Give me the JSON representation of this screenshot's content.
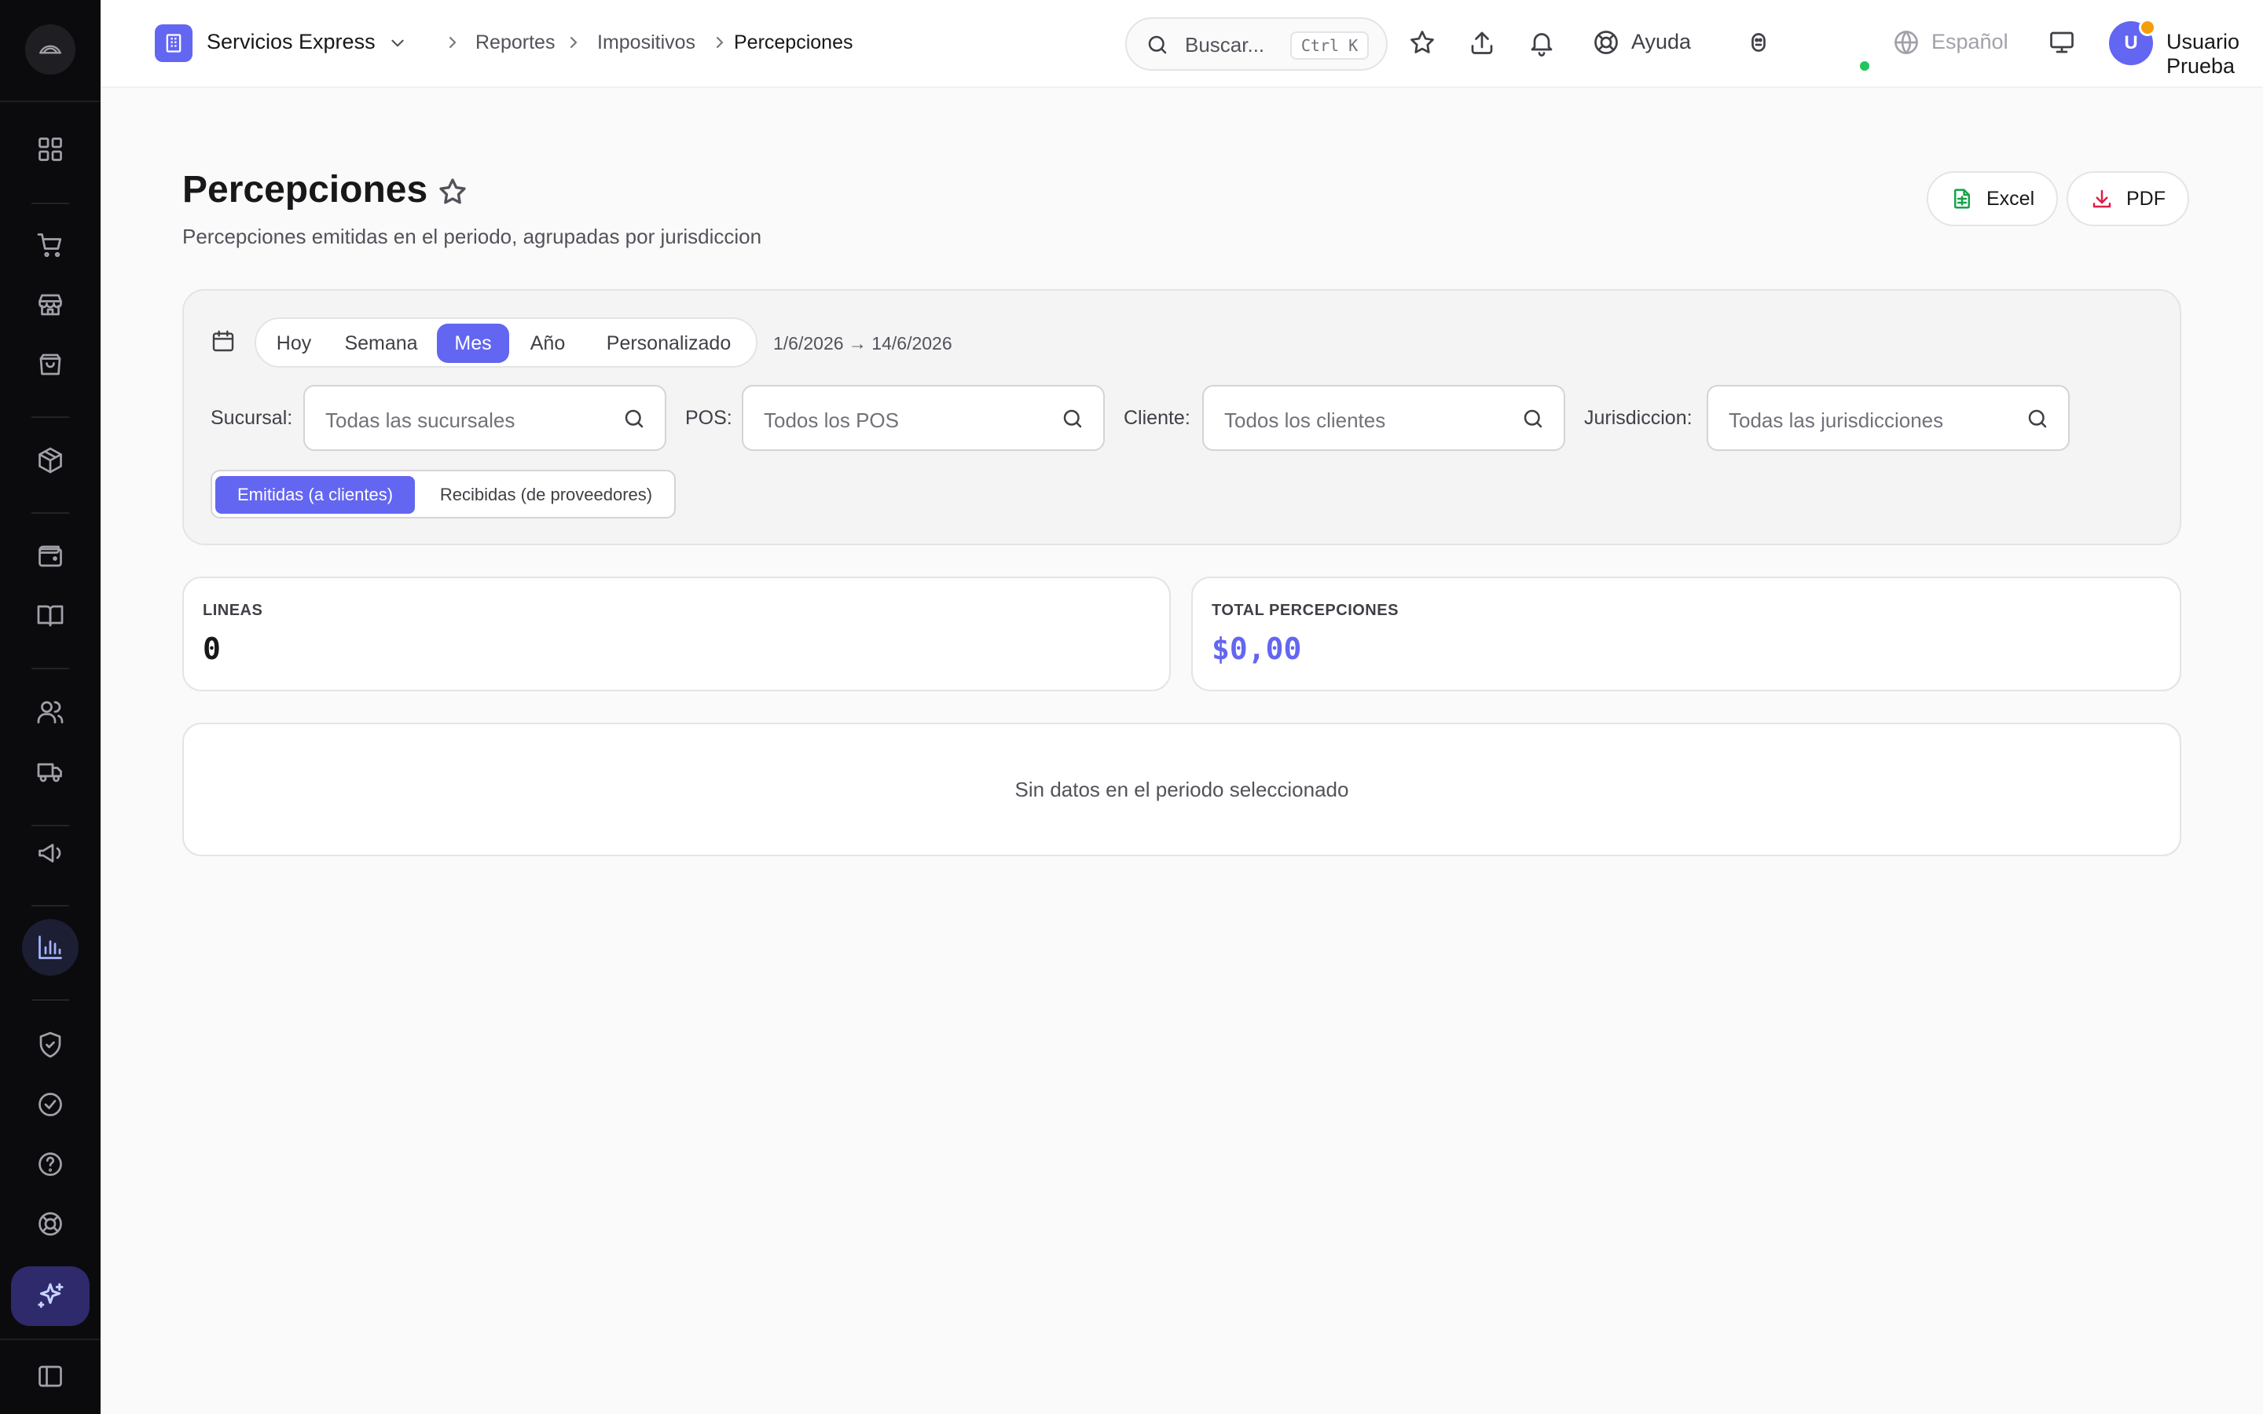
{
  "colors": {
    "accent": "#6366f1",
    "sidebar_bg": "#0b0b0d",
    "status_online": "#22c55e",
    "notification": "#f59e0b",
    "excel": "#16a34a",
    "pdf": "#e11d48"
  },
  "sidebar": {
    "icons": [
      "cube-logo-icon",
      "dashboard-grid-icon",
      "cart-icon",
      "store-icon",
      "shopping-bag-icon",
      "package-icon",
      "wallet-icon",
      "book-icon",
      "users-icon",
      "truck-icon",
      "megaphone-icon",
      "bar-chart-icon",
      "shield-check-icon",
      "check-circle-icon",
      "help-circle-icon",
      "lifebuoy-icon",
      "sparkles-icon",
      "sidebar-toggle-icon"
    ],
    "active": "bar-chart-icon"
  },
  "topbar": {
    "brand": "Servicios Express",
    "breadcrumb": [
      "Reportes",
      "Impositivos",
      "Percepciones"
    ],
    "search_placeholder": "Buscar...",
    "search_shortcut": "Ctrl K",
    "help_label": "Ayuda",
    "language": "Español",
    "user_initial": "U",
    "user_name": "Usuario Prueba"
  },
  "page": {
    "title": "Percepciones",
    "subtitle": "Percepciones emitidas en el periodo, agrupadas por jurisdiccion",
    "export_excel": "Excel",
    "export_pdf": "PDF"
  },
  "filters": {
    "periods": [
      "Hoy",
      "Semana",
      "Mes",
      "Año",
      "Personalizado"
    ],
    "active_period": "Mes",
    "date_range": "1/6/2026 → 14/6/2026",
    "fields": [
      {
        "label": "Sucursal:",
        "placeholder": "Todas las sucursales"
      },
      {
        "label": "POS:",
        "placeholder": "Todos los POS"
      },
      {
        "label": "Cliente:",
        "placeholder": "Todos los clientes"
      },
      {
        "label": "Jurisdiccion:",
        "placeholder": "Todas las jurisdicciones"
      }
    ],
    "types": [
      "Emitidas (a clientes)",
      "Recibidas (de proveedores)"
    ],
    "active_type": "Emitidas (a clientes)"
  },
  "stats": {
    "lines_label": "LINEAS",
    "lines_value": "0",
    "total_label": "TOTAL PERCEPCIONES",
    "total_value": "$0,00"
  },
  "empty_message": "Sin datos en el periodo seleccionado"
}
